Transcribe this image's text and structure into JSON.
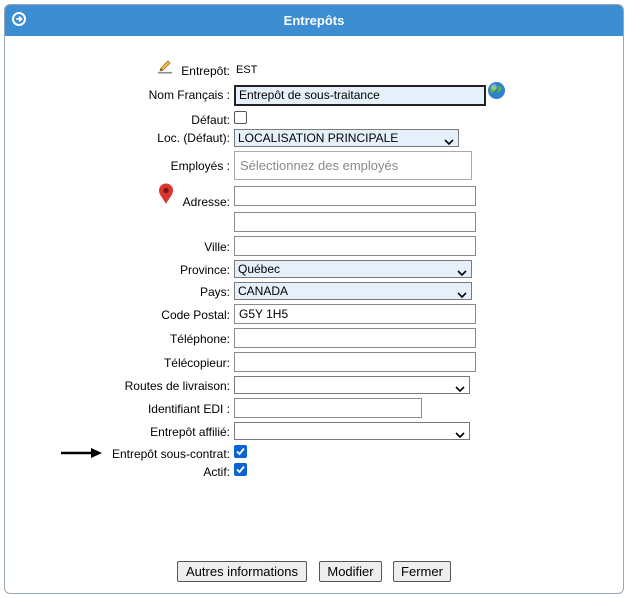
{
  "window": {
    "title": "Entrepôts"
  },
  "form": {
    "entrepot": {
      "label": "Entrepôt:",
      "value": "EST"
    },
    "nom_francais": {
      "label": "Nom Français :",
      "value": "Entrepôt de sous-traitance"
    },
    "defaut": {
      "label": "Défaut:",
      "checked": false
    },
    "localisation": {
      "label": "Loc. (Défaut):",
      "value": "LOCALISATION PRINCIPALE"
    },
    "employes": {
      "label": "Employés :",
      "placeholder": "Sélectionnez des employés"
    },
    "adresse": {
      "label": "Adresse:",
      "line1": "",
      "line2": ""
    },
    "ville": {
      "label": "Ville:",
      "value": ""
    },
    "province": {
      "label": "Province:",
      "value": "Québec"
    },
    "pays": {
      "label": "Pays:",
      "value": "CANADA"
    },
    "code_postal": {
      "label": "Code Postal:",
      "value": "G5Y 1H5"
    },
    "telephone": {
      "label": "Téléphone:",
      "value": ""
    },
    "telecopieur": {
      "label": "Télécopieur:",
      "value": ""
    },
    "routes_livraison": {
      "label": "Routes de livraison:",
      "value": ""
    },
    "identifiant_edi": {
      "label": "Identifiant EDI :",
      "value": ""
    },
    "entrepot_affilie": {
      "label": "Entrepôt affilié:",
      "value": ""
    },
    "entrepot_sous_contrat": {
      "label": "Entrepôt sous-contrat:",
      "checked": true
    },
    "actif": {
      "label": "Actif:",
      "checked": true
    }
  },
  "buttons": {
    "autres_informations": "Autres informations",
    "modifier": "Modifier",
    "fermer": "Fermer"
  },
  "colors": {
    "titlebar": "#3c8dd2",
    "highlight_field": "#e6f0fb",
    "checkbox_checked": "#0b63d6"
  },
  "icons": [
    "arrow-right-circle-icon",
    "edit-pencil-icon",
    "globe-icon",
    "map-pin-icon",
    "pointer-arrow-icon",
    "chevron-down-icon"
  ]
}
